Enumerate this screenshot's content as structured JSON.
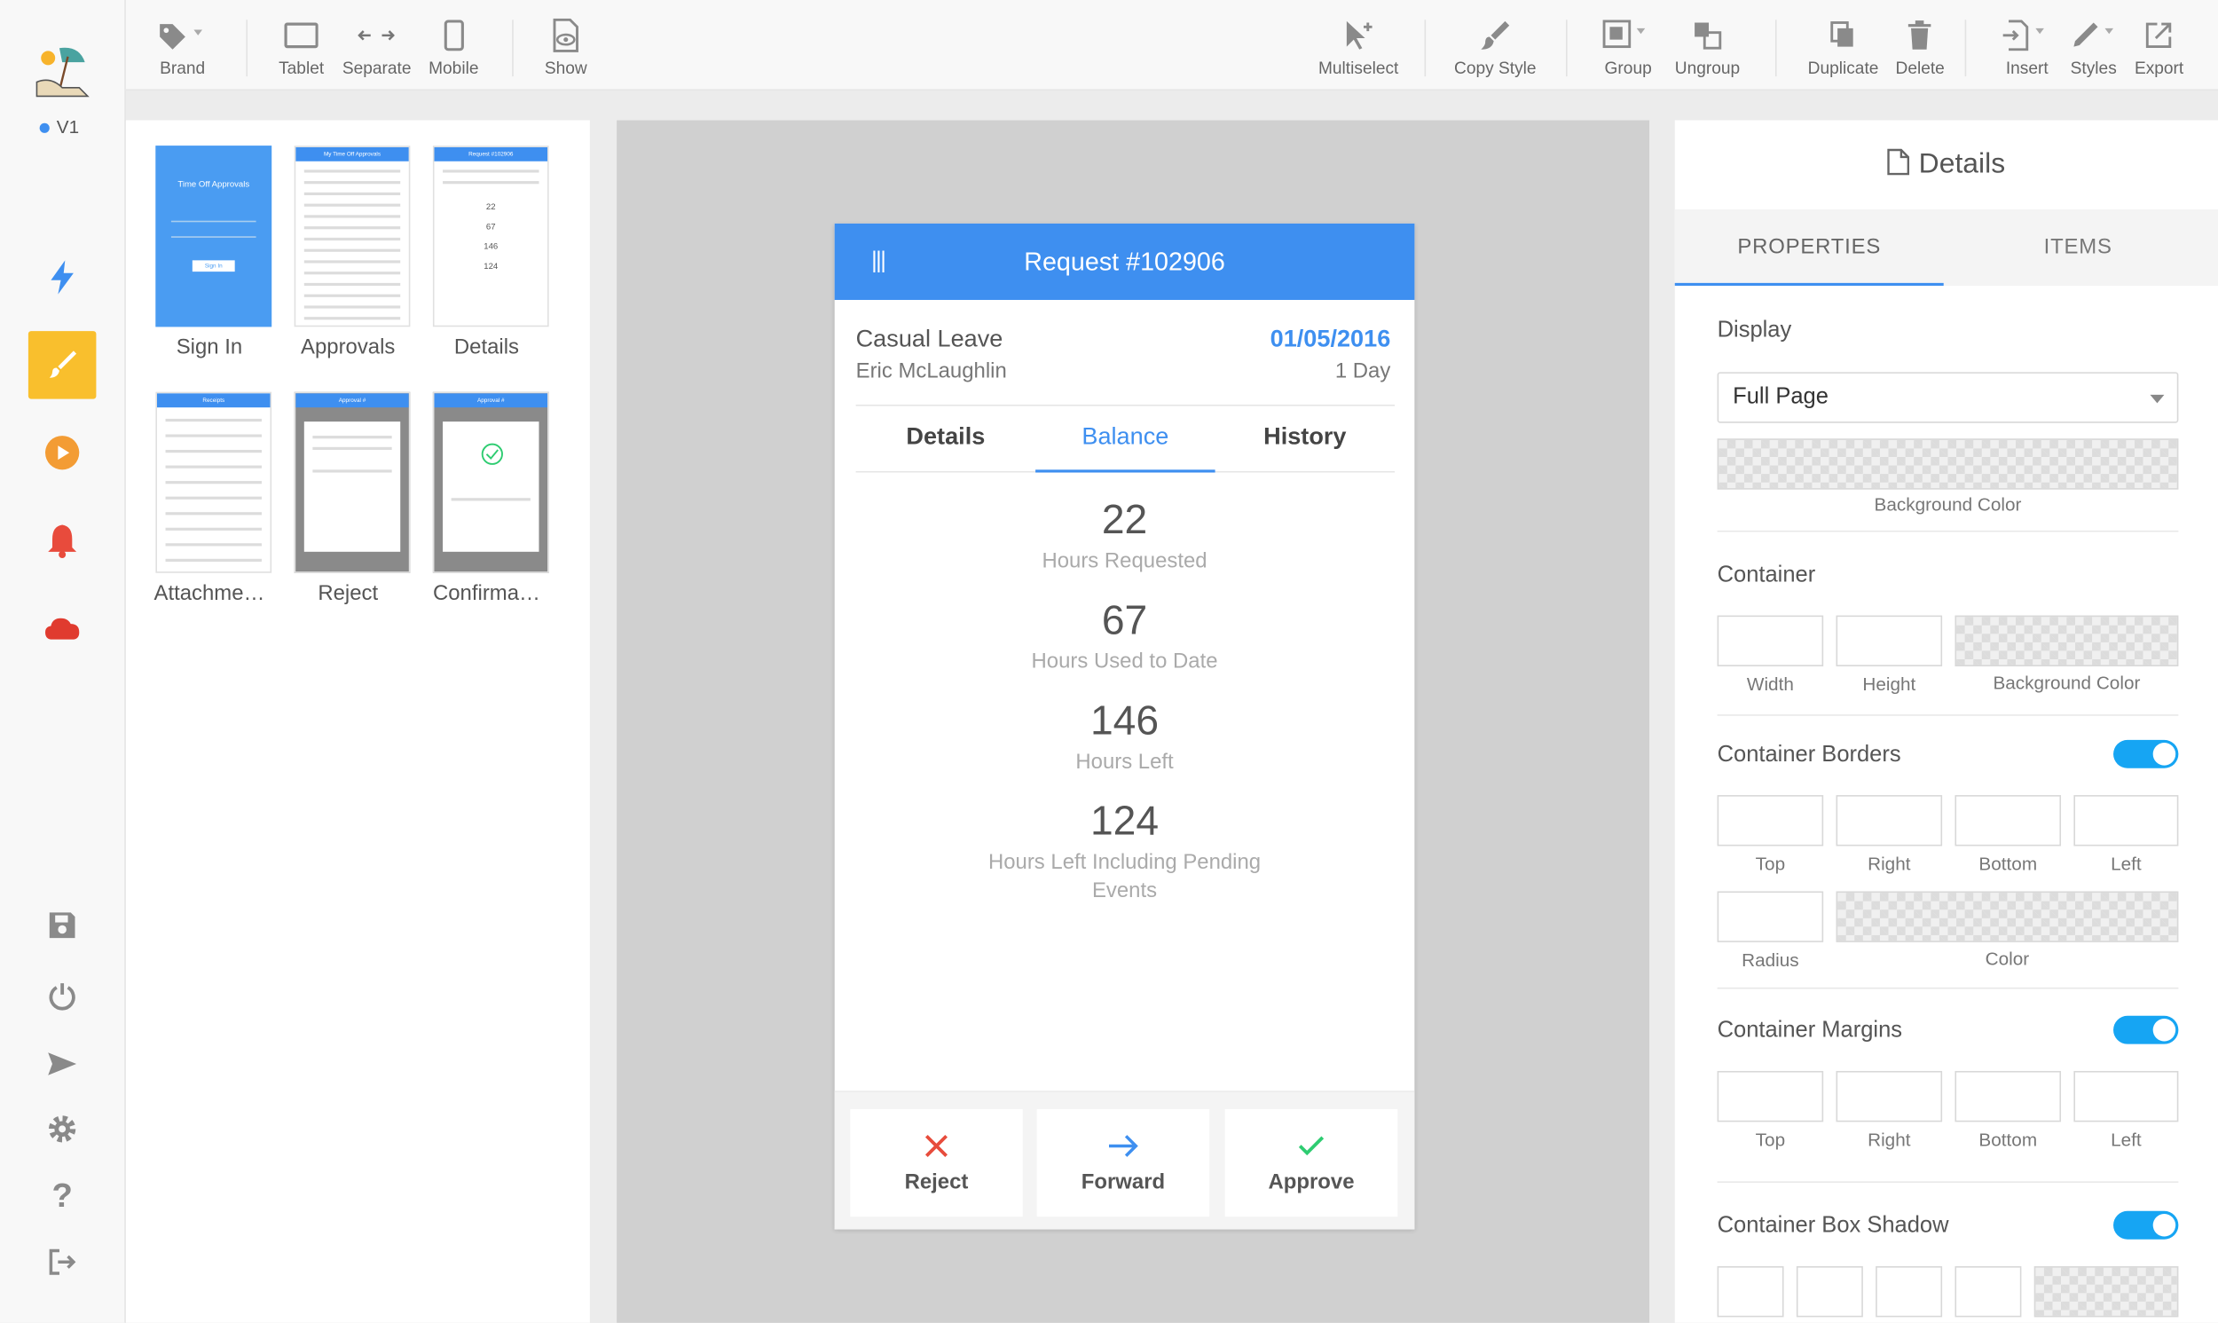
{
  "app": {
    "version": "V1"
  },
  "toolbar": {
    "brand": "Brand",
    "tablet": "Tablet",
    "separate": "Separate",
    "mobile": "Mobile",
    "show": "Show",
    "multiselect": "Multiselect",
    "copy_style": "Copy Style",
    "group": "Group",
    "ungroup": "Ungroup",
    "duplicate": "Duplicate",
    "delete": "Delete",
    "insert": "Insert",
    "styles": "Styles",
    "export": "Export"
  },
  "screens": [
    {
      "label": "Sign In",
      "thumb_title": "Time Off Approvals",
      "thumb_button": "Sign In"
    },
    {
      "label": "Approvals",
      "thumb_title": "My Time Off Approvals"
    },
    {
      "label": "Details",
      "thumb_title": "Request #102906"
    },
    {
      "label": "Attachme…",
      "thumb_title": "Receipts"
    },
    {
      "label": "Reject",
      "thumb_title": "Approval #"
    },
    {
      "label": "Confirma…",
      "thumb_title": "Approval #"
    }
  ],
  "phone": {
    "title": "Request #102906",
    "leave_type": "Casual Leave",
    "employee": "Eric McLaughlin",
    "date": "01/05/2016",
    "duration": "1 Day",
    "tabs": [
      "Details",
      "Balance",
      "History"
    ],
    "active_tab": "Balance",
    "stats": [
      {
        "value": "22",
        "label": "Hours Requested"
      },
      {
        "value": "67",
        "label": "Hours Used to Date"
      },
      {
        "value": "146",
        "label": "Hours Left"
      },
      {
        "value": "124",
        "label": "Hours Left Including Pending Events"
      }
    ],
    "actions": {
      "reject": "Reject",
      "forward": "Forward",
      "approve": "Approve"
    }
  },
  "details": {
    "title": "Details",
    "tabs": {
      "properties": "PROPERTIES",
      "items": "ITEMS"
    },
    "display_label": "Display",
    "display_value": "Full Page",
    "background_color": "Background Color",
    "container": "Container",
    "width": "Width",
    "height": "Height",
    "container_borders": "Container Borders",
    "top": "Top",
    "right": "Right",
    "bottom": "Bottom",
    "left": "Left",
    "radius": "Radius",
    "color": "Color",
    "container_margins": "Container Margins",
    "container_box_shadow": "Container Box Shadow"
  },
  "colors": {
    "accent": "#3e8ff0",
    "toggle": "#16a5f3",
    "active_rail": "#f9bf2d",
    "reject": "#e74c3c",
    "approve": "#2ecc71"
  }
}
